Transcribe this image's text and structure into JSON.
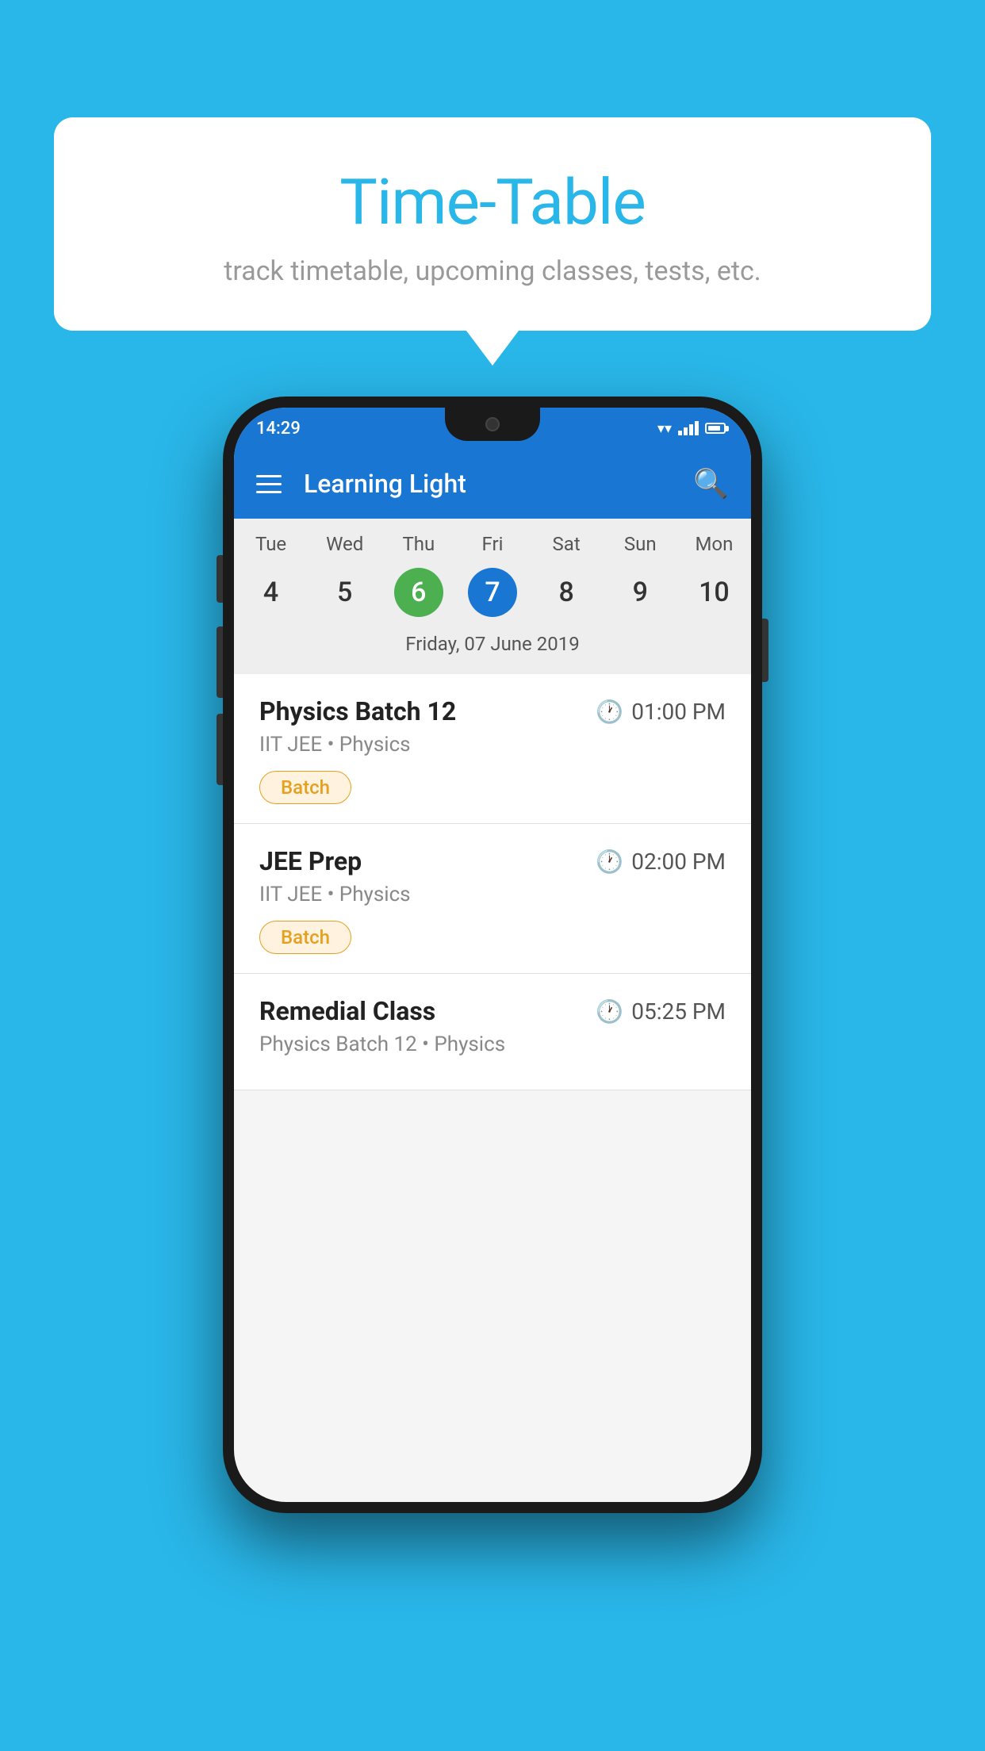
{
  "background_color": "#29B6E8",
  "bubble": {
    "title": "Time-Table",
    "subtitle": "track timetable, upcoming classes, tests, etc."
  },
  "phone": {
    "status_bar": {
      "time": "14:29"
    },
    "app_bar": {
      "title": "Learning Light"
    },
    "calendar": {
      "days_of_week": [
        "Tue",
        "Wed",
        "Thu",
        "Fri",
        "Sat",
        "Sun",
        "Mon"
      ],
      "dates": [
        "4",
        "5",
        "6",
        "7",
        "8",
        "9",
        "10"
      ],
      "today_index": 2,
      "selected_index": 3,
      "selected_date_label": "Friday, 07 June 2019"
    },
    "schedule": [
      {
        "title": "Physics Batch 12",
        "time": "01:00 PM",
        "subtitle": "IIT JEE • Physics",
        "badge": "Batch"
      },
      {
        "title": "JEE Prep",
        "time": "02:00 PM",
        "subtitle": "IIT JEE • Physics",
        "badge": "Batch"
      },
      {
        "title": "Remedial Class",
        "time": "05:25 PM",
        "subtitle": "Physics Batch 12 • Physics",
        "badge": ""
      }
    ]
  }
}
